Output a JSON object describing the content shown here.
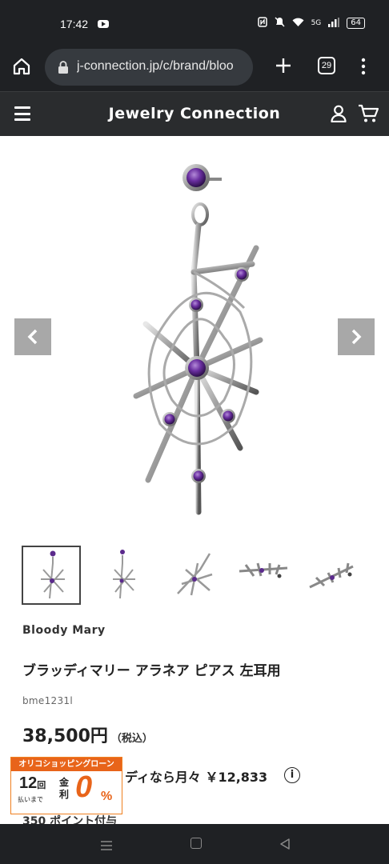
{
  "status_bar": {
    "time": "17:42",
    "icons": [
      "nfc-icon",
      "mute-icon",
      "wifi-icon",
      "signal-icon"
    ],
    "signal_label": "5G",
    "battery": "64"
  },
  "browser": {
    "url": "j-connection.jp/c/brand/bloo",
    "tab_count": "29"
  },
  "site": {
    "title": "Jewelry Connection"
  },
  "product": {
    "brand": "Bloody Mary",
    "name": "ブラッディマリー アラネア ピアス 左耳用",
    "sku": "bme1231l",
    "price": "38,500円",
    "tax_label": "（税込）",
    "loan_text": "ィディなら月々 ￥12,833",
    "points_text": "350 ポイント付与",
    "image_count": 5,
    "active_thumbnail": 1
  },
  "loan_banner": {
    "header": "オリコショッピングローン",
    "installments": "12",
    "installments_unit": "回",
    "sub": "払いまで",
    "kinri": "金利",
    "zero": "0",
    "percent": "%"
  },
  "colors": {
    "dark_bar": "#1f2124",
    "header_bg": "#2a2c2e",
    "accent_orange": "#e8641a",
    "amethyst": "#5b2a8c",
    "silver": "#b8b8b8"
  }
}
